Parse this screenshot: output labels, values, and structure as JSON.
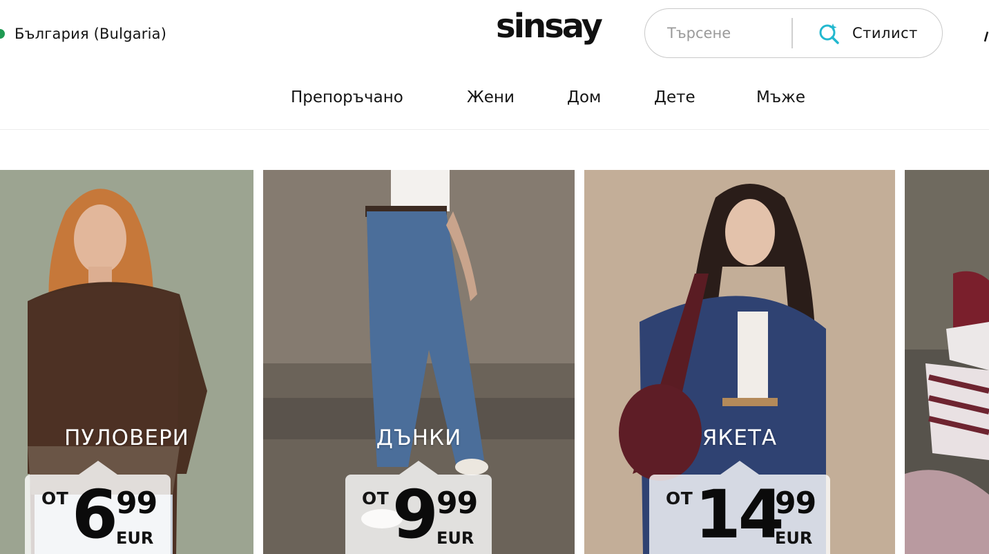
{
  "header": {
    "country": "България (Bulgaria)",
    "logo": "sinsay",
    "search_placeholder": "Търсене",
    "stylist_label": "Стилист"
  },
  "nav": {
    "items": [
      "Препоръчано",
      "Жени",
      "Дом",
      "Дете",
      "Мъже"
    ]
  },
  "cards": [
    {
      "title": "ПУЛОВЕРИ",
      "prefix": "ОТ",
      "price_int": "6",
      "price_dec": "99",
      "currency": "EUR"
    },
    {
      "title": "ДЪНКИ",
      "prefix": "ОТ",
      "price_int": "9",
      "price_dec": "99",
      "currency": "EUR"
    },
    {
      "title": "ЯКЕТА",
      "prefix": "ОТ",
      "price_int": "14",
      "price_dec": "99",
      "currency": "EUR"
    }
  ],
  "colors": {
    "country_dot": "#1f9a52",
    "stylist_icon": "#22b8cf"
  }
}
